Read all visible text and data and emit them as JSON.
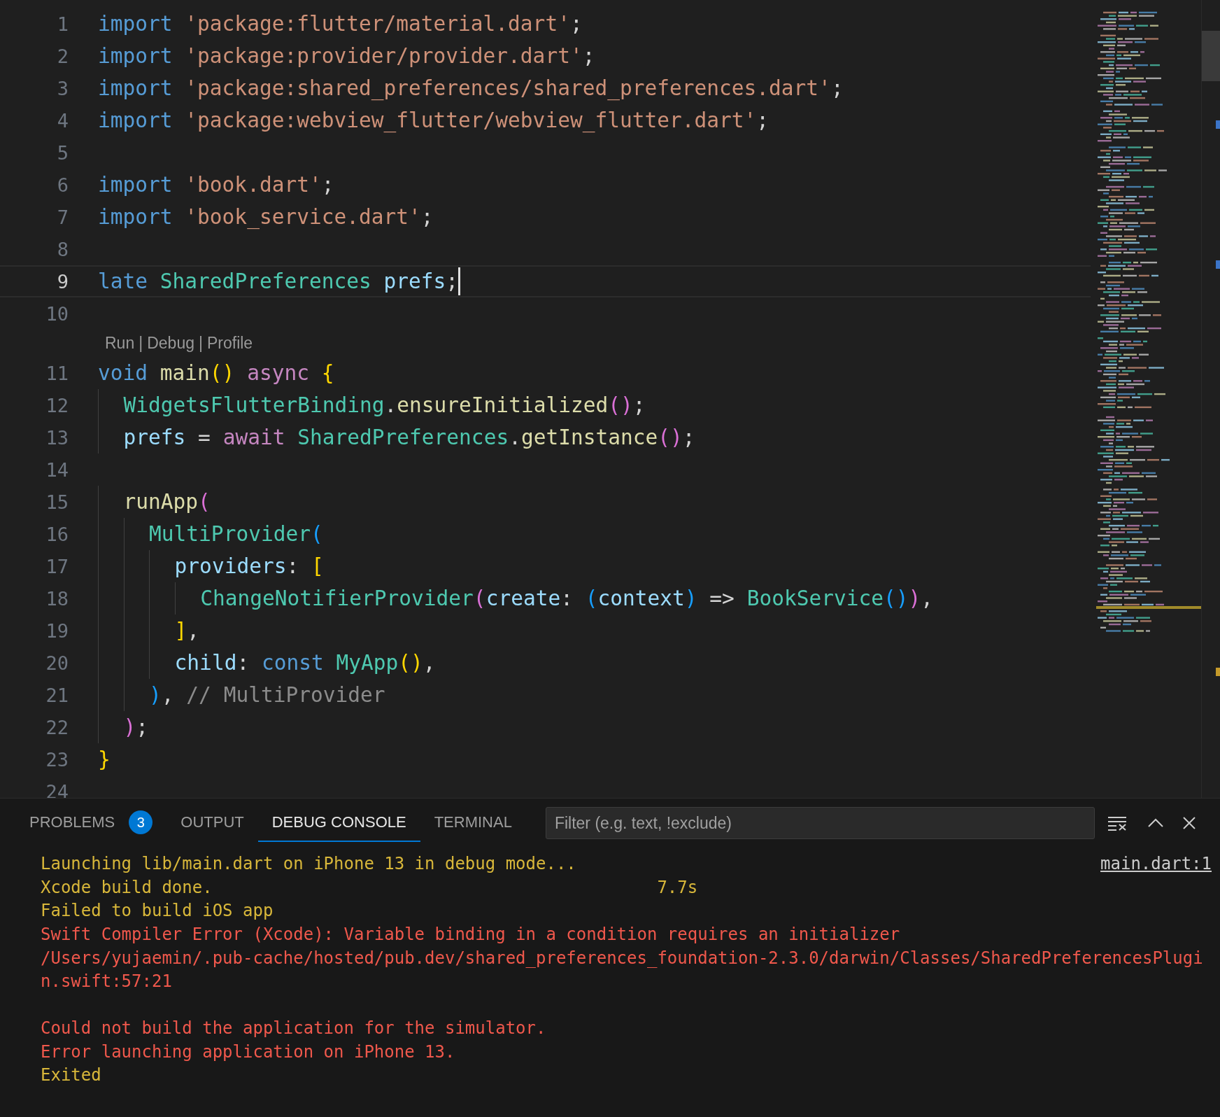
{
  "editor": {
    "lines": [
      {
        "number": "1",
        "current": false,
        "tokens": [
          {
            "text": "import ",
            "kind": "kw"
          },
          {
            "text": "'package:flutter/material.dart'",
            "kind": "str"
          },
          {
            "text": ";",
            "kind": "punct"
          }
        ]
      },
      {
        "number": "2",
        "current": false,
        "tokens": [
          {
            "text": "import ",
            "kind": "kw"
          },
          {
            "text": "'package:provider/provider.dart'",
            "kind": "str"
          },
          {
            "text": ";",
            "kind": "punct"
          }
        ]
      },
      {
        "number": "3",
        "current": false,
        "tokens": [
          {
            "text": "import ",
            "kind": "kw"
          },
          {
            "text": "'package:shared_preferences/shared_preferences.dart'",
            "kind": "str"
          },
          {
            "text": ";",
            "kind": "punct"
          }
        ]
      },
      {
        "number": "4",
        "current": false,
        "tokens": [
          {
            "text": "import ",
            "kind": "kw"
          },
          {
            "text": "'package:webview_flutter/webview_flutter.dart'",
            "kind": "str"
          },
          {
            "text": ";",
            "kind": "punct"
          }
        ]
      },
      {
        "number": "5",
        "current": false
      },
      {
        "number": "6",
        "current": false,
        "tokens": [
          {
            "text": "import ",
            "kind": "kw"
          },
          {
            "text": "'book.dart'",
            "kind": "str"
          },
          {
            "text": ";",
            "kind": "punct"
          }
        ]
      },
      {
        "number": "7",
        "current": false,
        "tokens": [
          {
            "text": "import ",
            "kind": "kw"
          },
          {
            "text": "'book_service.dart'",
            "kind": "str"
          },
          {
            "text": ";",
            "kind": "punct"
          }
        ]
      },
      {
        "number": "8",
        "current": false
      },
      {
        "number": "9",
        "current": true,
        "tokens": [
          {
            "text": "late ",
            "kind": "kw"
          },
          {
            "text": "SharedPreferences ",
            "kind": "type"
          },
          {
            "text": "prefs",
            "kind": "var"
          },
          {
            "text": ";",
            "kind": "punct"
          }
        ]
      },
      {
        "number": "10",
        "current": false
      },
      {
        "number": "11",
        "current": false,
        "codelens": {
          "separator": "|",
          "items": [
            "Run",
            "Debug",
            "Profile"
          ]
        },
        "tokens": [
          {
            "text": "void ",
            "kind": "kw"
          },
          {
            "text": "main",
            "kind": "fn"
          },
          {
            "text": "() ",
            "kind": "b1"
          },
          {
            "text": "async ",
            "kind": "ctrl"
          },
          {
            "text": "{",
            "kind": "b1"
          }
        ]
      },
      {
        "number": "12",
        "current": false,
        "tokens": [
          {
            "text": "  WidgetsFlutterBinding",
            "kind": "type"
          },
          {
            "text": ".",
            "kind": "punct"
          },
          {
            "text": "ensureInitialized",
            "kind": "fn"
          },
          {
            "text": "()",
            "kind": "b2"
          },
          {
            "text": ";",
            "kind": "punct"
          }
        ]
      },
      {
        "number": "13",
        "current": false,
        "tokens": [
          {
            "text": "  prefs",
            "kind": "var"
          },
          {
            "text": " = ",
            "kind": "punct"
          },
          {
            "text": "await ",
            "kind": "ctrl"
          },
          {
            "text": "SharedPreferences",
            "kind": "type"
          },
          {
            "text": ".",
            "kind": "punct"
          },
          {
            "text": "getInstance",
            "kind": "fn"
          },
          {
            "text": "()",
            "kind": "b2"
          },
          {
            "text": ";",
            "kind": "punct"
          }
        ]
      },
      {
        "number": "14",
        "current": false
      },
      {
        "number": "15",
        "current": false,
        "tokens": [
          {
            "text": "  runApp",
            "kind": "fn"
          },
          {
            "text": "(",
            "kind": "b2"
          }
        ]
      },
      {
        "number": "16",
        "current": false,
        "tokens": [
          {
            "text": "    MultiProvider",
            "kind": "type"
          },
          {
            "text": "(",
            "kind": "b3"
          }
        ]
      },
      {
        "number": "17",
        "current": false,
        "tokens": [
          {
            "text": "      providers",
            "kind": "var"
          },
          {
            "text": ": ",
            "kind": "punct"
          },
          {
            "text": "[",
            "kind": "b1"
          }
        ]
      },
      {
        "number": "18",
        "current": false,
        "tokens": [
          {
            "text": "        ChangeNotifierProvider",
            "kind": "type"
          },
          {
            "text": "(",
            "kind": "b2"
          },
          {
            "text": "create",
            "kind": "var"
          },
          {
            "text": ": ",
            "kind": "punct"
          },
          {
            "text": "(",
            "kind": "b3"
          },
          {
            "text": "context",
            "kind": "var"
          },
          {
            "text": ")",
            "kind": "b3"
          },
          {
            "text": " => ",
            "kind": "punct"
          },
          {
            "text": "BookService",
            "kind": "type"
          },
          {
            "text": "()",
            "kind": "b3"
          },
          {
            "text": ")",
            "kind": "b2"
          },
          {
            "text": ",",
            "kind": "punct"
          }
        ]
      },
      {
        "number": "19",
        "current": false,
        "tokens": [
          {
            "text": "      ]",
            "kind": "b1"
          },
          {
            "text": ",",
            "kind": "punct"
          }
        ]
      },
      {
        "number": "20",
        "current": false,
        "tokens": [
          {
            "text": "      child",
            "kind": "var"
          },
          {
            "text": ": ",
            "kind": "punct"
          },
          {
            "text": "const ",
            "kind": "kw"
          },
          {
            "text": "MyApp",
            "kind": "type"
          },
          {
            "text": "()",
            "kind": "b1"
          },
          {
            "text": ",",
            "kind": "punct"
          }
        ]
      },
      {
        "number": "21",
        "current": false,
        "tokens": [
          {
            "text": "    )",
            "kind": "b3"
          },
          {
            "text": ", ",
            "kind": "punct"
          },
          {
            "text": "// MultiProvider",
            "kind": "hint"
          }
        ]
      },
      {
        "number": "22",
        "current": false,
        "tokens": [
          {
            "text": "  )",
            "kind": "b2"
          },
          {
            "text": ";",
            "kind": "punct"
          }
        ]
      },
      {
        "number": "23",
        "current": false,
        "tokens": [
          {
            "text": "}",
            "kind": "b1"
          }
        ]
      },
      {
        "number": "24",
        "current": false
      }
    ]
  },
  "panel": {
    "tabs": [
      {
        "label": "PROBLEMS",
        "selected": false,
        "badge": "3"
      },
      {
        "label": "OUTPUT",
        "selected": false
      },
      {
        "label": "DEBUG CONSOLE",
        "selected": true
      },
      {
        "label": "TERMINAL",
        "selected": false
      }
    ],
    "filter": {
      "placeholder": "Filter (e.g. text, !exclude)"
    },
    "source_link": "main.dart:1",
    "console_blocks": [
      [
        {
          "text": "Launching lib/main.dart on iPhone 13 in debug mode...",
          "kind": "info"
        },
        {
          "text": "Xcode build done.                                            7.7s",
          "kind": "info"
        },
        {
          "text": "Failed to build iOS app",
          "kind": "info"
        },
        {
          "text": "Swift Compiler Error (Xcode): Variable binding in a condition requires an initializer",
          "kind": "error"
        },
        {
          "text": "/Users/yujaemin/.pub-cache/hosted/pub.dev/shared_preferences_foundation-2.3.0/darwin/Classes/SharedPreferencesPlugi",
          "kind": "error"
        },
        {
          "text": "n.swift:57:21",
          "kind": "error"
        }
      ],
      [
        {
          "text": "Could not build the application for the simulator.",
          "kind": "error"
        },
        {
          "text": "Error launching application on iPhone 13.",
          "kind": "error"
        },
        {
          "text": "Exited",
          "kind": "info"
        }
      ]
    ]
  }
}
